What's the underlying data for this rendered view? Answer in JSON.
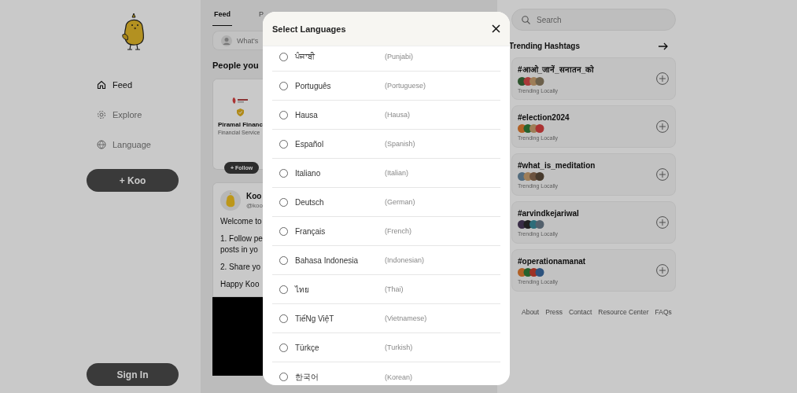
{
  "sidebar": {
    "nav": [
      {
        "label": "Feed",
        "selected": true
      },
      {
        "label": "Explore",
        "selected": false
      },
      {
        "label": "Language",
        "selected": false
      }
    ],
    "koo_button": "+ Koo",
    "sign_in_button": "Sign In"
  },
  "feed": {
    "tabs": [
      {
        "label": "Feed",
        "selected": true
      },
      {
        "label": "P",
        "selected": false
      }
    ],
    "composer_placeholder": "What's",
    "suggestions_title": "People you",
    "suggestion": {
      "name": "Piramal Financ",
      "category": "Financial Service",
      "verified": true,
      "follow_button": "+ Follow"
    },
    "post": {
      "author": "Koo",
      "handle": "@koo",
      "paragraphs": [
        "Welcome to",
        "1. Follow pe\nposts in yo",
        "2. Share yo",
        "Happy Koo"
      ]
    }
  },
  "modal": {
    "title": "Select Languages",
    "languages": [
      {
        "native": "ਪੰਜਾਬੀ",
        "english": "(Punjabi)",
        "selected": false
      },
      {
        "native": "Português",
        "english": "(Portuguese)",
        "selected": false
      },
      {
        "native": "Hausa",
        "english": "(Hausa)",
        "selected": false
      },
      {
        "native": "Español",
        "english": "(Spanish)",
        "selected": false
      },
      {
        "native": "Italiano",
        "english": "(Italian)",
        "selected": false
      },
      {
        "native": "Deutsch",
        "english": "(German)",
        "selected": false
      },
      {
        "native": "Français",
        "english": "(French)",
        "selected": false
      },
      {
        "native": "Bahasa Indonesia",
        "english": "(Indonesian)",
        "selected": false
      },
      {
        "native": "ไทย",
        "english": "(Thai)",
        "selected": false
      },
      {
        "native": "TiếNg ViệT",
        "english": "(Vietnamese)",
        "selected": false
      },
      {
        "native": "Türkçe",
        "english": "(Turkish)",
        "selected": false
      },
      {
        "native": "한국어",
        "english": "(Korean)",
        "selected": false
      }
    ]
  },
  "right": {
    "search_placeholder": "Search",
    "trending_title": "Trending Hashtags",
    "hashtags": [
      {
        "tag": "#आओ_जानें_सनातन_को",
        "subtitle": "Trending Locally"
      },
      {
        "tag": "#election2024",
        "subtitle": "Trending Locally"
      },
      {
        "tag": "#what_is_meditation",
        "subtitle": "Trending Locally"
      },
      {
        "tag": "#arvindkejariwal",
        "subtitle": "Trending Locally"
      },
      {
        "tag": "#operationamanat",
        "subtitle": "Trending Locally"
      }
    ],
    "footer_links": [
      "About",
      "Press",
      "Contact",
      "Resource Center",
      "FAQs"
    ]
  }
}
